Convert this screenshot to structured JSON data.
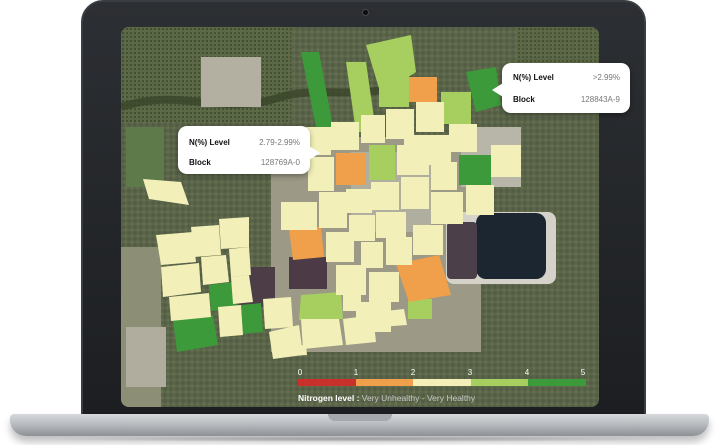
{
  "tooltips": [
    {
      "nlevel_key": "N(%) Level",
      "nlevel_value": "2.79-2.99%",
      "block_key": "Block",
      "block_value": "128769A-0"
    },
    {
      "nlevel_key": "N(%) Level",
      "nlevel_value": ">2.99%",
      "block_key": "Block",
      "block_value": "128843A-9"
    }
  ],
  "legend": {
    "ticks": [
      "0",
      "1",
      "2",
      "3",
      "4",
      "5"
    ],
    "colors": [
      "#c9302c",
      "#f0a04b",
      "#f2f0b8",
      "#a6cf5f",
      "#3c9a3a"
    ],
    "label": "Nitrogen level :",
    "description": "Very Unhealthy - Very Healthy"
  },
  "status_colors": {
    "very_unhealthy": "#c9302c",
    "unhealthy": "#f0a04b",
    "moderate": "#f2f0b8",
    "healthy": "#a6cf5f",
    "very_healthy": "#3c9a3a"
  }
}
